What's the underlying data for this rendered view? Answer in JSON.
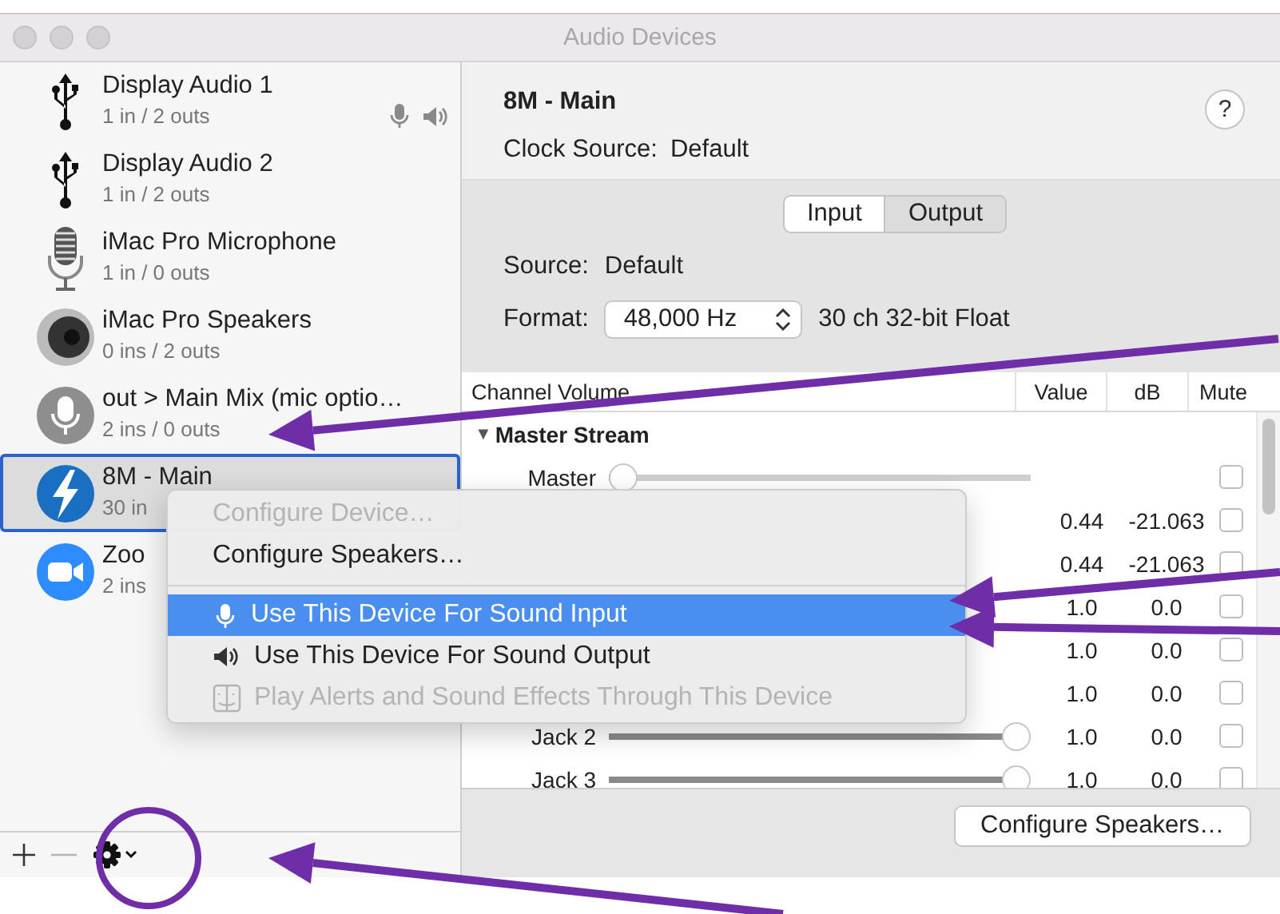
{
  "window": {
    "title": "Audio Devices"
  },
  "sidebar": {
    "devices": [
      {
        "name": "Display Audio 1",
        "channels": "1 in / 2 outs",
        "kind": "usb",
        "selected": false,
        "default_input": true,
        "default_output": true
      },
      {
        "name": "Display Audio 2",
        "channels": "1 in / 2 outs",
        "kind": "usb",
        "selected": false,
        "default_input": false,
        "default_output": false
      },
      {
        "name": "iMac Pro Microphone",
        "channels": "1 in / 0 outs",
        "kind": "microphone",
        "selected": false,
        "default_input": false,
        "default_output": false
      },
      {
        "name": "iMac Pro Speakers",
        "channels": "0 ins / 2 outs",
        "kind": "speaker",
        "selected": false,
        "default_input": false,
        "default_output": false
      },
      {
        "name": "out > Main Mix (mic optio…",
        "channels": "2 ins / 0 outs",
        "kind": "mic-badge",
        "selected": false,
        "default_input": false,
        "default_output": false
      },
      {
        "name": "8M - Main",
        "channels": "30 in",
        "kind": "thunderbolt",
        "selected": true,
        "default_input": false,
        "default_output": false
      },
      {
        "name": "Zoo",
        "channels": "2 ins",
        "kind": "camera",
        "selected": false,
        "default_input": false,
        "default_output": false
      }
    ]
  },
  "device": {
    "title": "8M - Main",
    "help": "?",
    "clock_source_label": "Clock Source:",
    "clock_source": "Default"
  },
  "tabs": [
    {
      "label": "Input",
      "selected": true
    },
    {
      "label": "Output",
      "selected": false
    }
  ],
  "source": {
    "label": "Source:",
    "value": "Default"
  },
  "format": {
    "label": "Format:",
    "value": "48,000 Hz",
    "detail": "30 ch 32-bit Float"
  },
  "table": {
    "columns": [
      "Channel Volume",
      "Value",
      "dB",
      "Mute"
    ],
    "groups": [
      {
        "label": "Master Stream",
        "toggle": "▼",
        "expanded": true,
        "rows": [
          {
            "label": "Master",
            "level": 0,
            "muted": false
          },
          {
            "value": "0.44",
            "db": "-21.063",
            "muted": false
          },
          {
            "value": "0.44",
            "db": "-21.063",
            "muted": false
          },
          {
            "value": "1.0",
            "db": "0.0",
            "muted": false
          },
          {
            "value": "1.0",
            "db": "0.0",
            "muted": false
          },
          {
            "value": "1.0",
            "db": "0.0",
            "muted": false
          },
          {
            "label": "Jack 2",
            "level": 1,
            "value": "1.0",
            "db": "0.0",
            "muted": false
          },
          {
            "label": "Jack 3",
            "level": 1,
            "value": "1.0",
            "db": "0.0",
            "muted": false
          }
        ]
      }
    ]
  },
  "footer_button": "Configure Speakers…",
  "context_menu": {
    "items": [
      {
        "kind": "plain",
        "label": "Configure Device…",
        "disabled": true,
        "selected": false
      },
      {
        "kind": "plain",
        "label": "Configure Speakers…",
        "disabled": false,
        "selected": false
      },
      {
        "kind": "separator"
      },
      {
        "kind": "microphone",
        "label": "Use This Device For Sound Input",
        "disabled": false,
        "selected": true
      },
      {
        "kind": "speaker",
        "label": "Use This Device For Sound Output",
        "disabled": false,
        "selected": false
      },
      {
        "kind": "finder",
        "label": "Play Alerts and Sound Effects Through This Device",
        "disabled": true,
        "selected": false
      }
    ]
  }
}
